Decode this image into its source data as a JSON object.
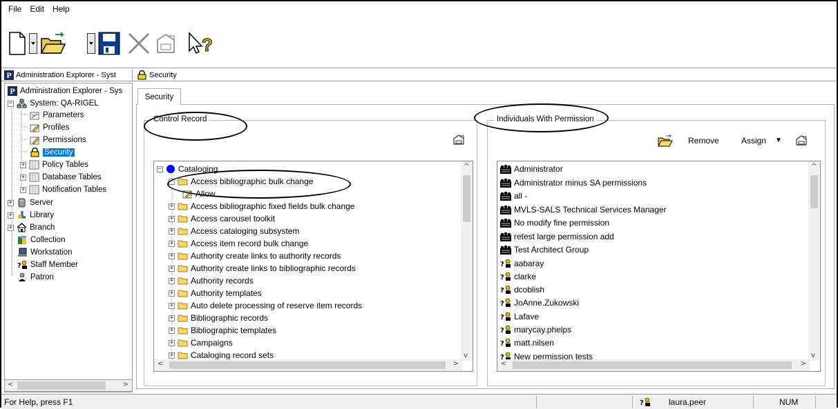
{
  "menu": [
    "File",
    "Edit",
    "Help"
  ],
  "panebar": {
    "left_title": "Administration Explorer - Syst",
    "right_title": "Security"
  },
  "tree": {
    "root": "Administration Explorer - Sys",
    "system": "System: QA-RIGEL",
    "items": [
      "Parameters",
      "Profiles",
      "Permissions",
      "Security",
      "Policy Tables",
      "Database Tables",
      "Notification Tables"
    ],
    "top_items": [
      "Server",
      "Library",
      "Branch",
      "Collection",
      "Workstation",
      "Staff Member",
      "Patron"
    ],
    "selected": "Security"
  },
  "tab": {
    "label": "Security"
  },
  "control_record": {
    "title": "Control Record",
    "root": "Cataloging",
    "expanded_item": "Access bibliographic bulk change",
    "child_item": "Allow",
    "items": [
      "Access bibliographic fixed fields bulk change",
      "Access carousel toolkit",
      "Access cataloging subsystem",
      "Access item record bulk change",
      "Authority create links to authority records",
      "Authority create links to bibliographic records",
      "Authority records",
      "Authority templates",
      "Auto delete processing of reserve item records",
      "Bibliographic records",
      "Bibliographic templates",
      "Campaigns",
      "Cataloging record sets"
    ]
  },
  "individuals": {
    "title": "Individuals With Permission",
    "remove_label": "Remove",
    "assign_label": "Assign",
    "groups": [
      "Administrator",
      "Administrator minus SA permissions",
      "all -",
      "MVLS-SALS Technical Services Manager",
      "No modify fine permission",
      "retest large permission add",
      "Test Architect Group"
    ],
    "users": [
      "aabaray",
      "clarke",
      "dcoblish",
      "JoAnne.Zukowski",
      "Lafave",
      "marycay.phelps",
      "matt.nilsen",
      "New permission tests"
    ]
  },
  "status": {
    "help": "For Help, press F1",
    "user": "laura.peer",
    "num": "NUM"
  },
  "colors": {
    "selection": "#0078d7",
    "folder": "#f5d76e",
    "cataloging_dot": "#0000ff"
  }
}
